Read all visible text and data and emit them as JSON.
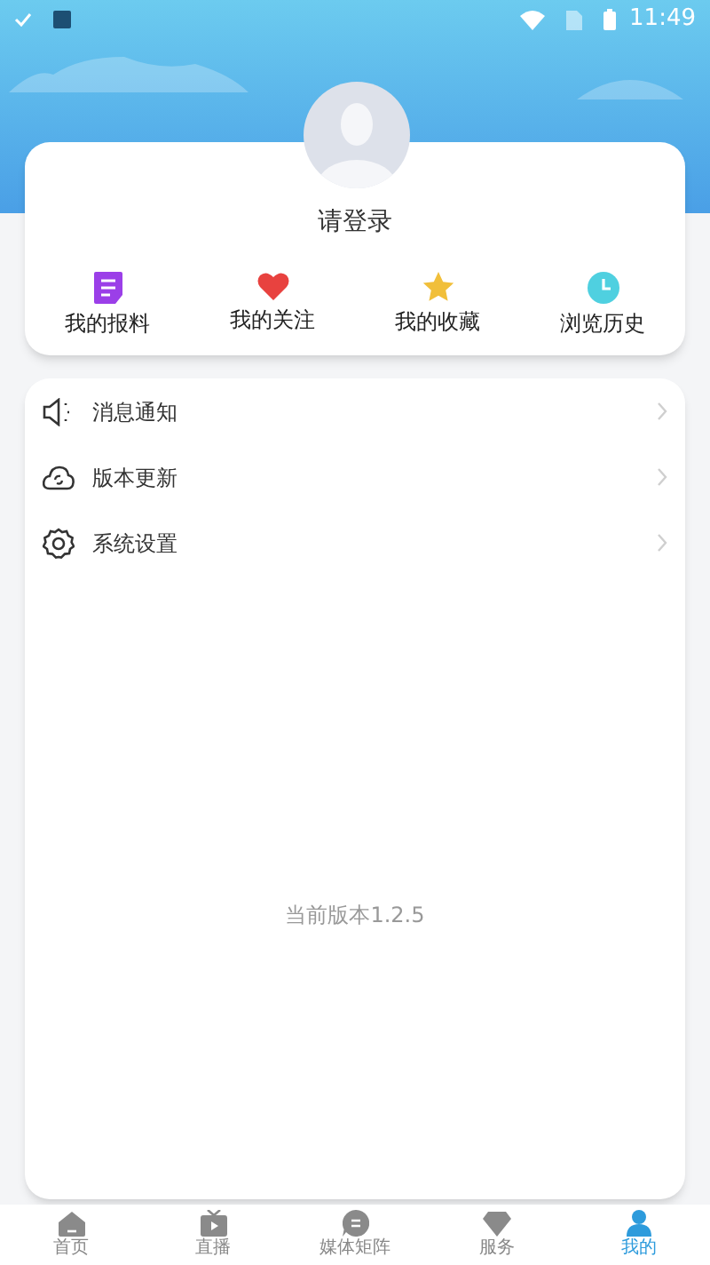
{
  "status_bar": {
    "time": "11:49"
  },
  "profile": {
    "login_prompt": "请登录"
  },
  "shortcuts": [
    {
      "kind": "report",
      "label": "我的报料"
    },
    {
      "kind": "follow",
      "label": "我的关注"
    },
    {
      "kind": "favorite",
      "label": "我的收藏"
    },
    {
      "kind": "history",
      "label": "浏览历史"
    }
  ],
  "menu": [
    {
      "kind": "notify",
      "label": "消息通知"
    },
    {
      "kind": "update",
      "label": "版本更新"
    },
    {
      "kind": "settings",
      "label": "系统设置"
    }
  ],
  "version_text": "当前版本1.2.5",
  "tabs": [
    {
      "kind": "home",
      "label": "首页",
      "selected": false
    },
    {
      "kind": "live",
      "label": "直播",
      "selected": false
    },
    {
      "kind": "media",
      "label": "媒体矩阵",
      "selected": false
    },
    {
      "kind": "service",
      "label": "服务",
      "selected": false
    },
    {
      "kind": "mine",
      "label": "我的",
      "selected": true
    }
  ]
}
